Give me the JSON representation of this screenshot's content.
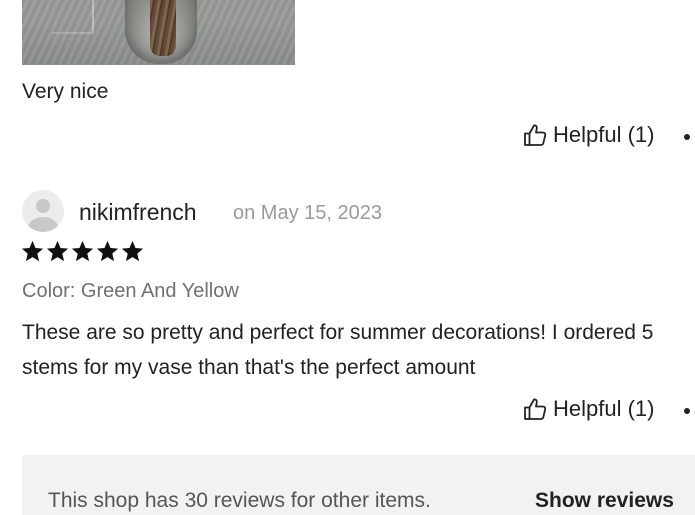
{
  "review_1": {
    "text": "Very nice",
    "helpful_label": "Helpful (1)"
  },
  "review_2": {
    "username": "nikimfrench",
    "date": "on May 15, 2023",
    "rating": 5,
    "variant": "Color: Green And Yellow",
    "text": "These are so pretty and perfect for summer decorations! I ordered 5 stems for my vase than that's the perfect amount",
    "helpful_label": "Helpful (1)"
  },
  "footer": {
    "text": "This shop has 30 reviews for other items.",
    "link": "Show reviews"
  },
  "icons": {
    "helpful": "thumbs-up-icon",
    "star": "star-icon",
    "avatar": "user-avatar-icon"
  },
  "colors": {
    "text": "#222222",
    "muted": "#9a9a9a",
    "variant": "#707070",
    "footer_bg": "#f2f2f2"
  }
}
